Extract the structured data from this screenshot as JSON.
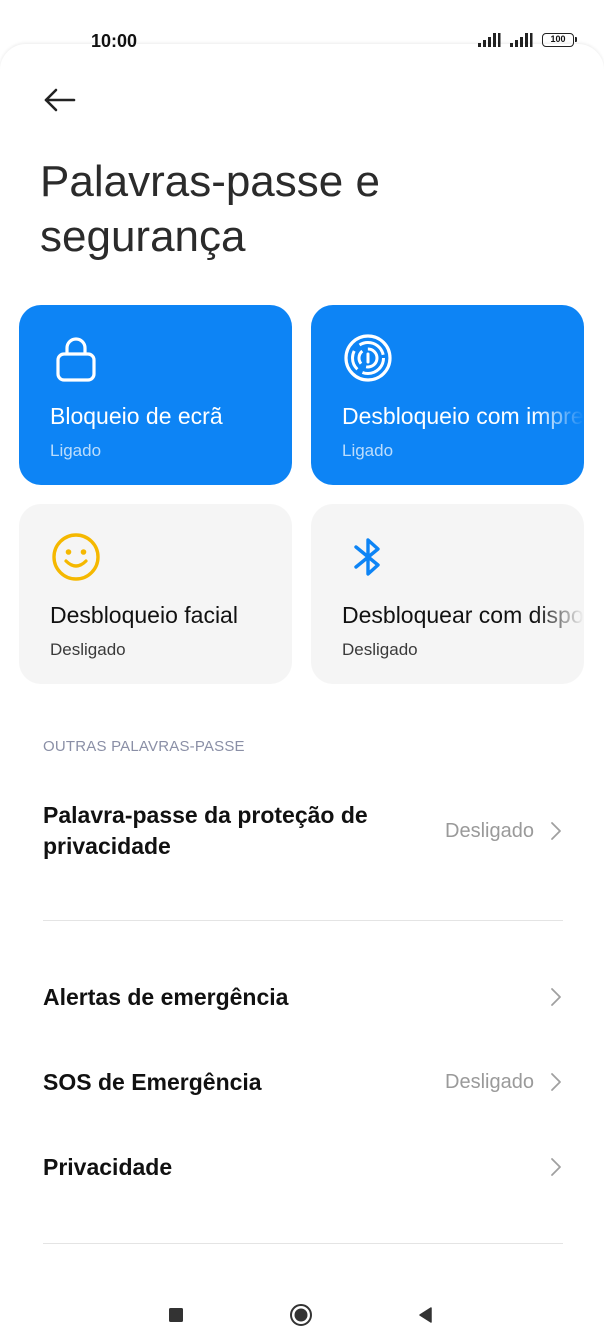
{
  "status_bar": {
    "time": "10:00",
    "battery": "100",
    "icons": [
      "signal-icon",
      "signal-icon",
      "battery-icon"
    ]
  },
  "header": {
    "title": "Palavras-passe e segurança",
    "back_icon": "back-arrow-icon"
  },
  "tiles": [
    {
      "label": "Bloqueio de ecrã",
      "status": "Ligado",
      "icon": "lock-icon",
      "active": true
    },
    {
      "label": "Desbloqueio com impressão digital",
      "status": "Ligado",
      "icon": "fingerprint-icon",
      "active": true
    },
    {
      "label": "Desbloqueio facial",
      "status": "Desligado",
      "icon": "smiley-face-icon",
      "active": false
    },
    {
      "label": "Desbloquear com dispositivo Bluetooth",
      "status": "Desligado",
      "icon": "bluetooth-icon",
      "active": false
    }
  ],
  "section": {
    "header": "OUTRAS PALAVRAS-PASSE"
  },
  "rows": [
    {
      "label": "Palavra-passe da proteção de privacidade",
      "value": "Desligado"
    },
    {
      "label": "Alertas de emergência",
      "value": ""
    },
    {
      "label": "SOS de Emergência",
      "value": "Desligado"
    },
    {
      "label": "Privacidade",
      "value": ""
    }
  ],
  "colors": {
    "accent": "#0d84f5",
    "tile_inactive": "#f5f5f5",
    "face_icon": "#f5b800",
    "bluetooth_icon": "#0d84f5"
  },
  "nav": [
    "recents-square-icon",
    "home-circle-icon",
    "back-triangle-icon"
  ]
}
